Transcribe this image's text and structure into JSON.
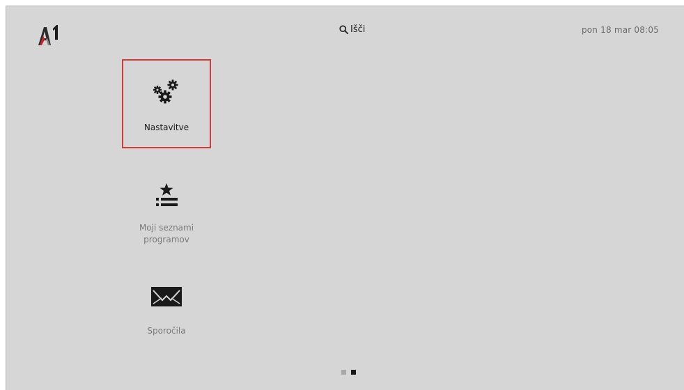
{
  "header": {
    "logo_alt": "A1",
    "search_label": "Išči",
    "datetime": "pon 18 mar 08:05"
  },
  "menu": {
    "items": [
      {
        "label": "Nastavitve",
        "icon": "gears-icon",
        "selected": true
      },
      {
        "label": "Moji seznami programov",
        "icon": "star-list-icon",
        "selected": false
      },
      {
        "label": "Sporočila",
        "icon": "envelope-icon",
        "selected": false
      }
    ]
  },
  "pager": {
    "pages": 2,
    "active": 2
  },
  "colors": {
    "background": "#d6d6d6",
    "selection": "#d43a3a",
    "text_primary": "#1a1a1a",
    "text_secondary": "#7a7a7a"
  }
}
